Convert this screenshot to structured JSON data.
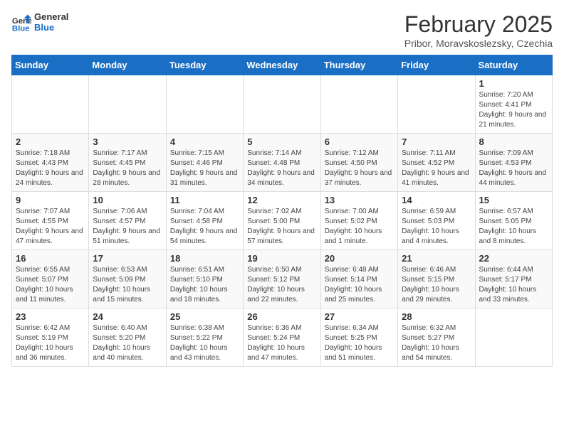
{
  "logo": {
    "text_general": "General",
    "text_blue": "Blue"
  },
  "title": "February 2025",
  "subtitle": "Pribor, Moravskoslezsky, Czechia",
  "days_of_week": [
    "Sunday",
    "Monday",
    "Tuesday",
    "Wednesday",
    "Thursday",
    "Friday",
    "Saturday"
  ],
  "weeks": [
    [
      {
        "day": "",
        "info": ""
      },
      {
        "day": "",
        "info": ""
      },
      {
        "day": "",
        "info": ""
      },
      {
        "day": "",
        "info": ""
      },
      {
        "day": "",
        "info": ""
      },
      {
        "day": "",
        "info": ""
      },
      {
        "day": "1",
        "info": "Sunrise: 7:20 AM\nSunset: 4:41 PM\nDaylight: 9 hours and 21 minutes."
      }
    ],
    [
      {
        "day": "2",
        "info": "Sunrise: 7:18 AM\nSunset: 4:43 PM\nDaylight: 9 hours and 24 minutes."
      },
      {
        "day": "3",
        "info": "Sunrise: 7:17 AM\nSunset: 4:45 PM\nDaylight: 9 hours and 28 minutes."
      },
      {
        "day": "4",
        "info": "Sunrise: 7:15 AM\nSunset: 4:46 PM\nDaylight: 9 hours and 31 minutes."
      },
      {
        "day": "5",
        "info": "Sunrise: 7:14 AM\nSunset: 4:48 PM\nDaylight: 9 hours and 34 minutes."
      },
      {
        "day": "6",
        "info": "Sunrise: 7:12 AM\nSunset: 4:50 PM\nDaylight: 9 hours and 37 minutes."
      },
      {
        "day": "7",
        "info": "Sunrise: 7:11 AM\nSunset: 4:52 PM\nDaylight: 9 hours and 41 minutes."
      },
      {
        "day": "8",
        "info": "Sunrise: 7:09 AM\nSunset: 4:53 PM\nDaylight: 9 hours and 44 minutes."
      }
    ],
    [
      {
        "day": "9",
        "info": "Sunrise: 7:07 AM\nSunset: 4:55 PM\nDaylight: 9 hours and 47 minutes."
      },
      {
        "day": "10",
        "info": "Sunrise: 7:06 AM\nSunset: 4:57 PM\nDaylight: 9 hours and 51 minutes."
      },
      {
        "day": "11",
        "info": "Sunrise: 7:04 AM\nSunset: 4:58 PM\nDaylight: 9 hours and 54 minutes."
      },
      {
        "day": "12",
        "info": "Sunrise: 7:02 AM\nSunset: 5:00 PM\nDaylight: 9 hours and 57 minutes."
      },
      {
        "day": "13",
        "info": "Sunrise: 7:00 AM\nSunset: 5:02 PM\nDaylight: 10 hours and 1 minute."
      },
      {
        "day": "14",
        "info": "Sunrise: 6:59 AM\nSunset: 5:03 PM\nDaylight: 10 hours and 4 minutes."
      },
      {
        "day": "15",
        "info": "Sunrise: 6:57 AM\nSunset: 5:05 PM\nDaylight: 10 hours and 8 minutes."
      }
    ],
    [
      {
        "day": "16",
        "info": "Sunrise: 6:55 AM\nSunset: 5:07 PM\nDaylight: 10 hours and 11 minutes."
      },
      {
        "day": "17",
        "info": "Sunrise: 6:53 AM\nSunset: 5:09 PM\nDaylight: 10 hours and 15 minutes."
      },
      {
        "day": "18",
        "info": "Sunrise: 6:51 AM\nSunset: 5:10 PM\nDaylight: 10 hours and 18 minutes."
      },
      {
        "day": "19",
        "info": "Sunrise: 6:50 AM\nSunset: 5:12 PM\nDaylight: 10 hours and 22 minutes."
      },
      {
        "day": "20",
        "info": "Sunrise: 6:48 AM\nSunset: 5:14 PM\nDaylight: 10 hours and 25 minutes."
      },
      {
        "day": "21",
        "info": "Sunrise: 6:46 AM\nSunset: 5:15 PM\nDaylight: 10 hours and 29 minutes."
      },
      {
        "day": "22",
        "info": "Sunrise: 6:44 AM\nSunset: 5:17 PM\nDaylight: 10 hours and 33 minutes."
      }
    ],
    [
      {
        "day": "23",
        "info": "Sunrise: 6:42 AM\nSunset: 5:19 PM\nDaylight: 10 hours and 36 minutes."
      },
      {
        "day": "24",
        "info": "Sunrise: 6:40 AM\nSunset: 5:20 PM\nDaylight: 10 hours and 40 minutes."
      },
      {
        "day": "25",
        "info": "Sunrise: 6:38 AM\nSunset: 5:22 PM\nDaylight: 10 hours and 43 minutes."
      },
      {
        "day": "26",
        "info": "Sunrise: 6:36 AM\nSunset: 5:24 PM\nDaylight: 10 hours and 47 minutes."
      },
      {
        "day": "27",
        "info": "Sunrise: 6:34 AM\nSunset: 5:25 PM\nDaylight: 10 hours and 51 minutes."
      },
      {
        "day": "28",
        "info": "Sunrise: 6:32 AM\nSunset: 5:27 PM\nDaylight: 10 hours and 54 minutes."
      },
      {
        "day": "",
        "info": ""
      }
    ]
  ]
}
